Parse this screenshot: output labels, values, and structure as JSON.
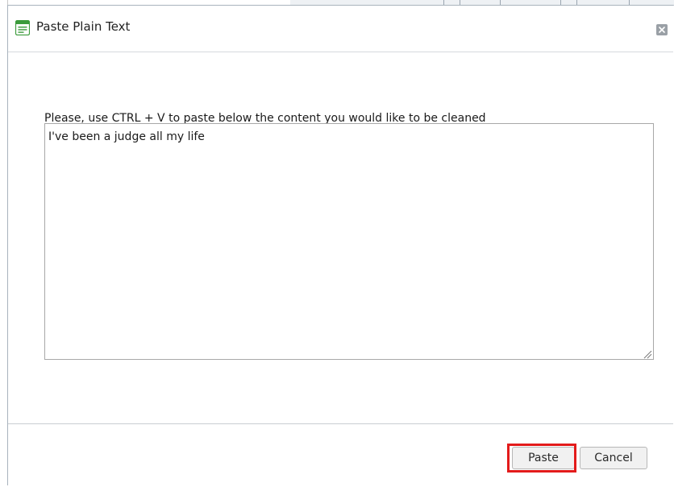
{
  "dialog": {
    "title": "Paste Plain Text",
    "close_icon": "close-icon",
    "title_icon": "document-window-icon"
  },
  "body": {
    "instruction": "Please, use CTRL + V to paste below the content you would like to be cleaned",
    "textarea_value": "I've been a judge all my life"
  },
  "footer": {
    "paste_label": "Paste",
    "cancel_label": "Cancel",
    "highlight_color": "#e31b1b"
  },
  "colors": {
    "accent_green": "#3b9b3b",
    "border": "#a8a8a8"
  }
}
